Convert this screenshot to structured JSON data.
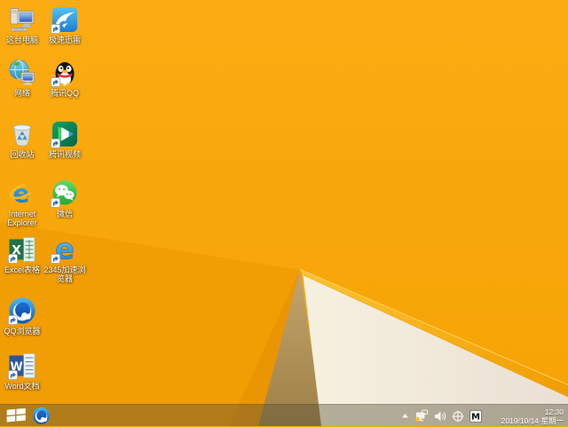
{
  "desktop": {
    "icons": [
      {
        "id": "this-pc",
        "label": "这台电脑",
        "shortcut": false
      },
      {
        "id": "xunlei-speed",
        "label": "极速迅雷",
        "shortcut": true
      },
      {
        "id": "network",
        "label": "网络",
        "shortcut": false
      },
      {
        "id": "tencent-qq",
        "label": "腾讯QQ",
        "shortcut": true
      },
      {
        "id": "recycle-bin",
        "label": "回收站",
        "shortcut": false
      },
      {
        "id": "tencent-video",
        "label": "腾讯视频",
        "shortcut": true
      },
      {
        "id": "internet-explorer",
        "label": "Internet\nExplorer",
        "shortcut": false
      },
      {
        "id": "wechat",
        "label": "微信",
        "shortcut": true
      },
      {
        "id": "excel",
        "label": "Excel表格",
        "shortcut": true
      },
      {
        "id": "2345-browser",
        "label": "2345加速浏\n览器",
        "shortcut": true
      },
      {
        "id": "qq-browser",
        "label": "QQ浏览器",
        "shortcut": true
      },
      {
        "id": "word",
        "label": "Word文档",
        "shortcut": true
      }
    ]
  },
  "taskbar": {
    "pinned": [
      {
        "id": "qq-browser"
      }
    ],
    "tray": {
      "icons": [
        "show-hidden-icons",
        "network-status",
        "volume",
        "safely-remove",
        "ime-indicator"
      ],
      "ime_label": "M",
      "clock_time": "12:30",
      "clock_date": "2019/10/14 星期一"
    }
  },
  "wallpaper": {
    "style": "windows-8.1-default-folded-paper",
    "colors": {
      "base_orange": "#F8A808",
      "lower_left_orange": "#F19D04",
      "dark_wedge": "#EA9502",
      "tan_fold": "#B29358",
      "cream_fold": "#F3ECDB",
      "ridge_highlight": "#FFBE2E",
      "taskbar_tint": "rgba(86,80,58,0.42)"
    }
  }
}
